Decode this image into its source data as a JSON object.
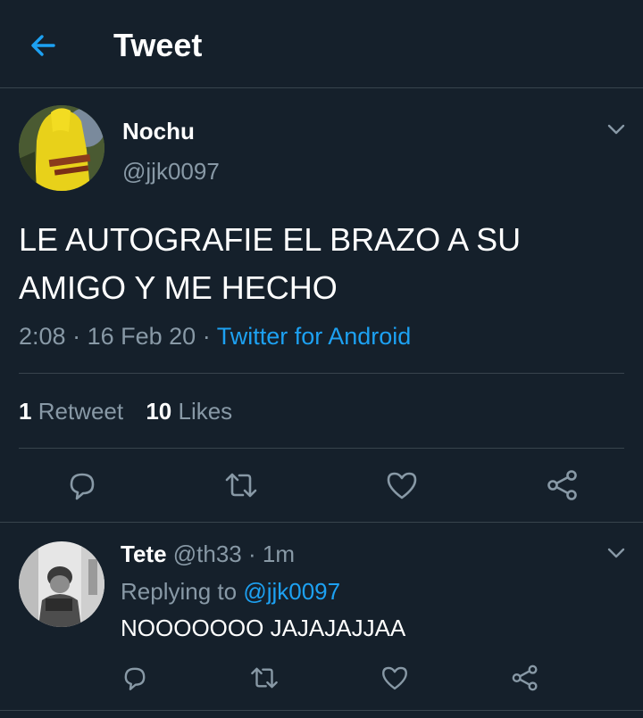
{
  "colors": {
    "background": "#15202b",
    "accent": "#1da1f2",
    "secondary_text": "#8899a6",
    "divider": "#38444d"
  },
  "header": {
    "title": "Tweet",
    "back_icon": "arrow-left-icon"
  },
  "tweet": {
    "author_name": "Nochu",
    "author_handle": "@jjk0097",
    "text_line1": "LE AUTOGRAFIE EL BRAZO A SU",
    "text_line2": "AMIGO Y ME HECHO",
    "time": "2:08",
    "date": "16 Feb 20",
    "source": "Twitter for Android",
    "retweet_count": "1",
    "retweet_label": "Retweet",
    "like_count": "10",
    "like_label": "Likes",
    "actions": [
      "reply-icon",
      "retweet-icon",
      "like-icon",
      "share-icon"
    ]
  },
  "reply": {
    "author_name": "Tete",
    "author_handle": "@th33",
    "age": "1m",
    "replying_prefix": "Replying to",
    "replying_handle": "@jjk0097",
    "text": "NOOOOOOO JAJAJAJJAA",
    "actions": [
      "reply-icon",
      "retweet-icon",
      "like-icon",
      "share-icon"
    ]
  }
}
